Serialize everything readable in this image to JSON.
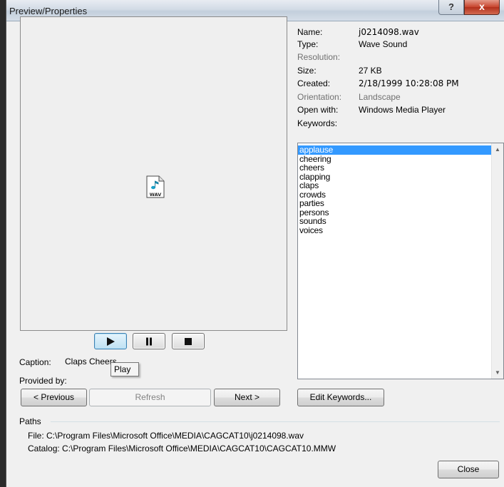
{
  "window": {
    "title": "Preview/Properties",
    "help_label": "?",
    "close_label": "x"
  },
  "preview": {
    "icon_text": "WAV"
  },
  "media_controls": {
    "play_tooltip": "Play"
  },
  "caption": {
    "label": "Caption:",
    "value": "Claps Cheers"
  },
  "provided_by": {
    "label": "Provided by:"
  },
  "nav": {
    "previous": "< Previous",
    "refresh": "Refresh",
    "next": "Next >"
  },
  "properties": {
    "name_label": "Name:",
    "name_value": "j0214098.wav",
    "type_label": "Type:",
    "type_value": "Wave Sound",
    "resolution_label": "Resolution:",
    "size_label": "Size:",
    "size_value": "27 KB",
    "created_label": "Created:",
    "created_value": "2/18/1999 10:28:08 PM",
    "orientation_label": "Orientation:",
    "orientation_value": "Landscape",
    "open_with_label": "Open with:",
    "open_with_value": "Windows Media Player"
  },
  "keywords": {
    "label": "Keywords:",
    "items": [
      "applause",
      "cheering",
      "cheers",
      "clapping",
      "claps",
      "crowds",
      "parties",
      "persons",
      "sounds",
      "voices"
    ],
    "edit_button": "Edit Keywords..."
  },
  "paths": {
    "label": "Paths",
    "file": "File: C:\\Program Files\\Microsoft Office\\MEDIA\\CAGCAT10\\j0214098.wav",
    "catalog": "Catalog: C:\\Program Files\\Microsoft Office\\MEDIA\\CAGCAT10\\CAGCAT10.MMW"
  },
  "footer": {
    "close_button": "Close"
  },
  "colors": {
    "selection": "#3399ff",
    "title_close": "#c7432c"
  }
}
